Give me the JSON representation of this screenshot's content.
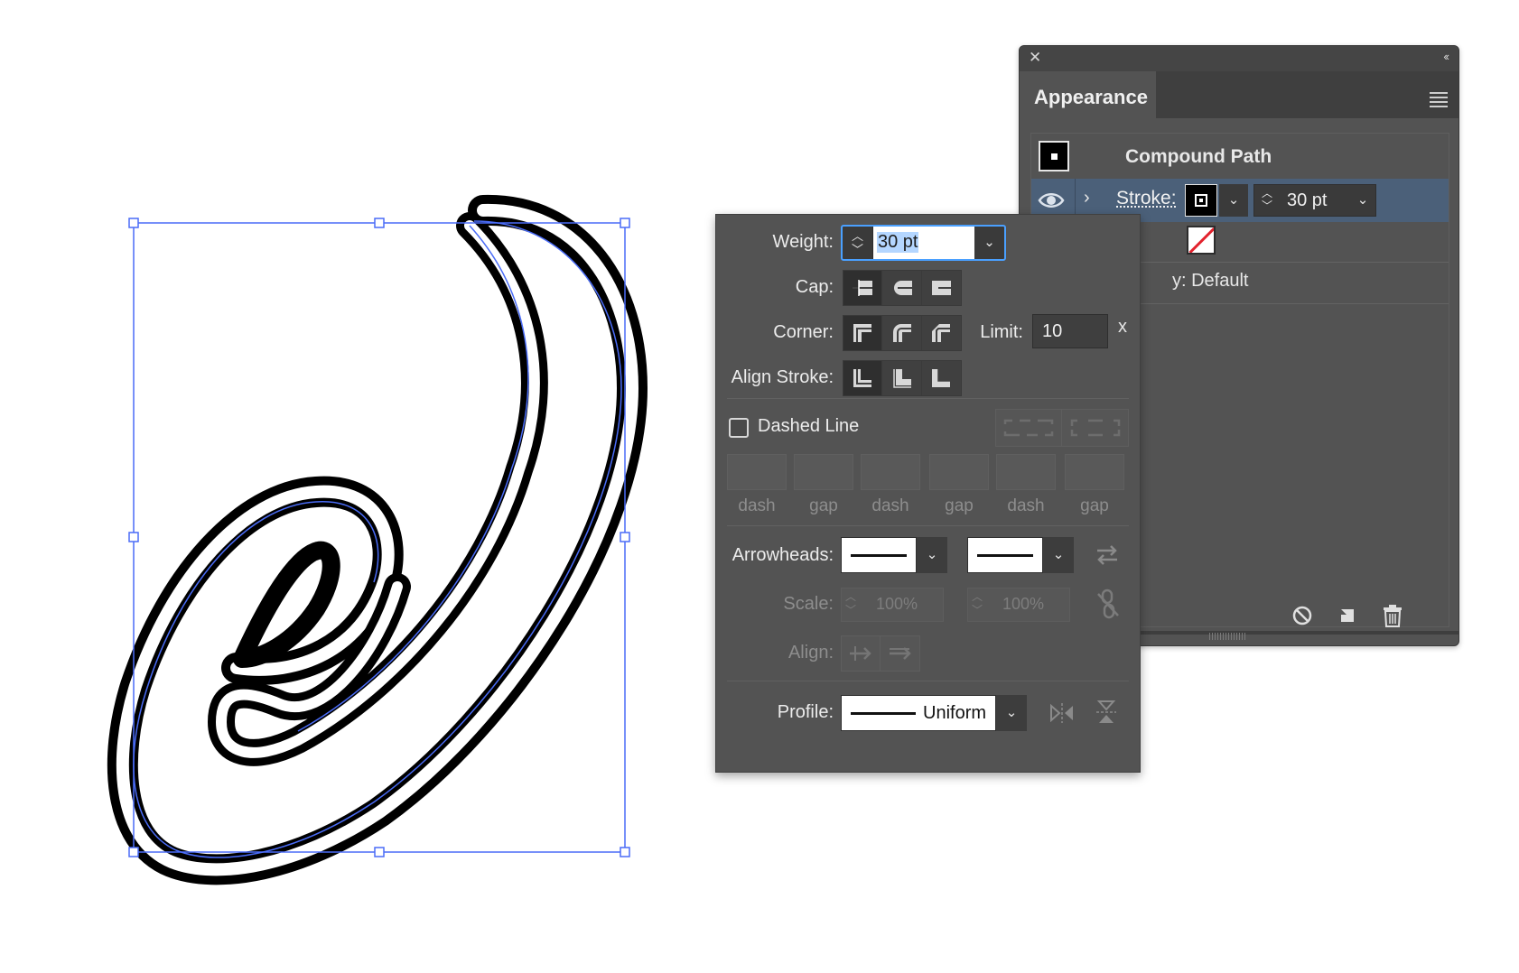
{
  "appearance_panel": {
    "close_glyph": "✕",
    "collapse_glyph": "‹‹",
    "tab_label": "Appearance",
    "object_type": "Compound Path",
    "stroke_label": "Stroke:",
    "stroke_weight": "30 pt",
    "opacity_label": "y: Default",
    "icons": [
      "eye-icon",
      "chevron-right-icon",
      "panel-menu-icon",
      "clear-appearance-icon",
      "duplicate-item-icon",
      "delete-item-icon"
    ]
  },
  "stroke_panel": {
    "weight_label": "Weight:",
    "weight_value": "30 pt",
    "cap_label": "Cap:",
    "corner_label": "Corner:",
    "limit_label": "Limit:",
    "limit_value": "10",
    "limit_suffix": "x",
    "align_label": "Align Stroke:",
    "dashed_label": "Dashed Line",
    "dashed_checked": false,
    "dash_fields": [
      "dash",
      "gap",
      "dash",
      "gap",
      "dash",
      "gap"
    ],
    "arrowheads_label": "Arrowheads:",
    "scale_label": "Scale:",
    "scale_start": "100%",
    "scale_end": "100%",
    "align_arrows_label": "Align:",
    "profile_label": "Profile:",
    "profile_value": "Uniform"
  },
  "colors": {
    "panel_bg": "#535353",
    "selection_blue": "#4a6cf7",
    "highlight_row": "#4b6079",
    "focus_ring": "#4aa0ff"
  }
}
